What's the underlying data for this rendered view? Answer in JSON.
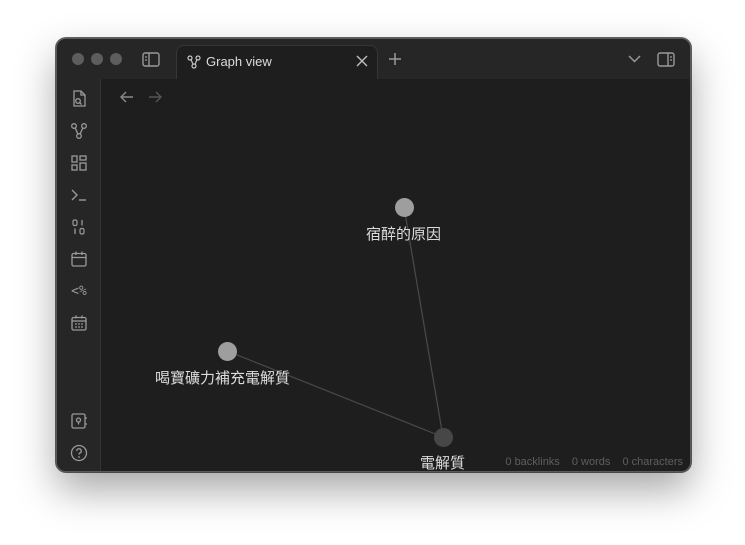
{
  "window": {
    "tab": {
      "label": "Graph view",
      "icon": "graph-icon"
    }
  },
  "ribbon": {
    "items": [
      "file-search-icon",
      "graph-icon",
      "blocks-icon",
      "terminal-icon",
      "binary-icon",
      "calendar-icon",
      "code-percent-icon",
      "calendar-grid-icon",
      "vault-icon",
      "help-icon",
      "settings-icon"
    ],
    "code_glyph": "<%"
  },
  "graph": {
    "nodes": [
      {
        "label": "宿醉的原因",
        "color": "#9e9e9e"
      },
      {
        "label": "喝寶礦力補充電解質",
        "color": "#9e9e9e"
      },
      {
        "label": "電解質",
        "color": "#474747"
      }
    ],
    "edges": [
      [
        "宿醉的原因",
        "電解質"
      ],
      [
        "喝寶礦力補充電解質",
        "電解質"
      ]
    ],
    "edge_color": "#4a4a4a"
  },
  "status": {
    "backlinks": "0 backlinks",
    "words": "0 words",
    "characters": "0 characters"
  }
}
